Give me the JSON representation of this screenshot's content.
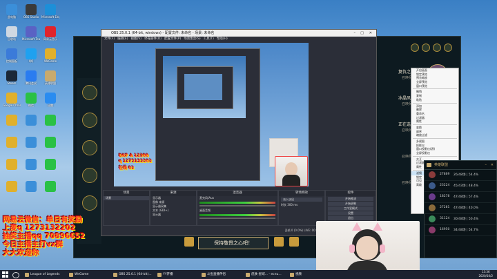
{
  "desktop": {
    "icons": [
      {
        "label": "此电脑",
        "color": "#3b8fd9"
      },
      {
        "label": "OBS Studio",
        "color": "#3a3a3a"
      },
      {
        "label": "Microsoft Edge",
        "color": "#1d8fd8"
      },
      {
        "label": "回收站",
        "color": "#cfd8e2"
      },
      {
        "label": "Microsoft Teams",
        "color": "#5a62c4"
      },
      {
        "label": "网易云音乐",
        "color": "#e0242c"
      },
      {
        "label": "控制面板",
        "color": "#3b7bd9"
      },
      {
        "label": "QQ",
        "color": "#1fa1f0"
      },
      {
        "label": "WeGame",
        "color": "#e0b02c"
      },
      {
        "label": "Steam",
        "color": "#1b2838"
      },
      {
        "label": "腾讯会议",
        "color": "#2a7cf0"
      },
      {
        "label": "英雄联盟",
        "color": "#c8aa6e"
      },
      {
        "label": "Google Chrome",
        "color": "#e0b02c"
      },
      {
        "label": "微信",
        "color": "#2ac145"
      },
      {
        "label": "迅雷",
        "color": "#2a8cf0"
      }
    ]
  },
  "game": {
    "app_name": "League of Legends",
    "champions": [
      {
        "name": "复仇之矛",
        "sub": "召唤师1",
        "color": "#6a4a6a"
      },
      {
        "name": "冰晶凤凰",
        "sub": "召唤师2",
        "color": "#4a7a9a"
      },
      {
        "name": "正在选用......",
        "sub": "召唤师3",
        "color": "#5a4a8a"
      },
      {
        "name": "",
        "sub": "召唤师4",
        "color": "#1c2a2e"
      },
      {
        "name": "",
        "sub": "召唤师5",
        "color": "#1c2a2e"
      }
    ],
    "lock_button": "保持敬畏之心吧！"
  },
  "obs": {
    "title": "OBS 25.0.1 (64-bit, windows) - 配置文件: 未命名 - 场景: 未命名",
    "menu": [
      "文件(F)",
      "编辑(E)",
      "视图(V)",
      "停靠部件(D)",
      "配置文件(P)",
      "场景集合(S)",
      "工具(T)",
      "帮助(H)"
    ],
    "docks": {
      "scenes": "场景",
      "sources": "来源",
      "mixer": "混音器",
      "transitions": "转场特效",
      "controls": "控件"
    },
    "scene_items": [
      "场景"
    ],
    "source_items": [
      "显示器",
      "图像 来源",
      "显示器采集",
      "文本 (GDI+)",
      "显示器"
    ],
    "mixer_items": [
      "麦克风/Aux",
      "桌面音频"
    ],
    "transition": {
      "type": "淡入淡出",
      "duration_label": "时长",
      "duration": "300 ms"
    },
    "controls": [
      "开始推流",
      "开始录制",
      "工作室模式",
      "设置",
      "退出"
    ],
    "status": "丢帧 0 (0.0%)   LIVE: 00:00:00   REC: 00:00:00   CPU: 5.1%, 30.00 fps",
    "context_menu": [
      "开启画面",
      "锁定预览",
      "预览缩放",
      "全屏预览",
      "窗口预览",
      "",
      "撤销",
      "复制",
      "粘贴",
      "",
      "添加",
      "删除",
      "重命名",
      "过滤器",
      "属性",
      "",
      "变换",
      "顺序",
      "缩放过滤",
      "",
      "多视图",
      "投影仪",
      "窗口投影仪(源)",
      "全屏投影仪",
      "",
      "交互",
      "过滤器",
      "属性",
      "",
      "滤镜",
      "锁定",
      "可见",
      "高级"
    ],
    "context_highlight": 29
  },
  "friends": {
    "title": "英雄联盟",
    "rows": [
      {
        "name": "27869",
        "stat": "26/48场 | 54.4%"
      },
      {
        "name": "23224",
        "stat": "45/43场 | 48.4%"
      },
      {
        "name": "18278",
        "stat": "47/48场 | 57.4%"
      },
      {
        "name": "27281",
        "stat": "47/48场 | 40.0%"
      },
      {
        "name": "31124",
        "stat": "30/48场 | 50.4%"
      },
      {
        "name": "16950",
        "stat": "34/48场 | 54.7%"
      }
    ]
  },
  "overlay": {
    "lines": [
      "网易云微信：单日有奖励",
      "上麦q 1273132202",
      "抽奖主播qq 70896652",
      "今日主播主打vx群",
      "大大欢迎你"
    ],
    "small": [
      "DKF A 12300",
      "q 1273132202",
      "在线 02"
    ]
  },
  "taskbar": {
    "items": [
      "League of Legends",
      "WeGame",
      "OBS 25.0.1 (64-bit)...",
      "YY开播",
      "斗鱼直播伴侣",
      "皮肤-星域... - ecnu...",
      "视频"
    ],
    "time": "13:36",
    "date": "2020/10/2"
  },
  "colors": {
    "accent": "#c8aa6e",
    "obs_bg": "#2b2e38",
    "game_bg": "#0d1a20"
  }
}
